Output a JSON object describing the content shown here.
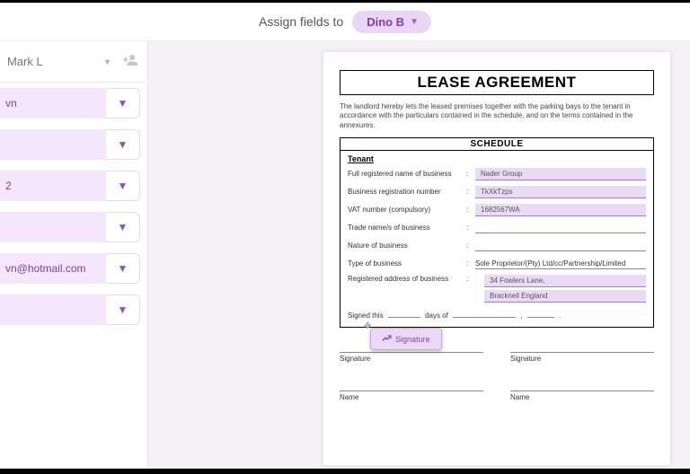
{
  "topbar": {
    "assign_label": "Assign fields to",
    "assignee": "Dino B"
  },
  "sidebar": {
    "current_user": "Mark L",
    "fields": [
      {
        "label": "vn"
      },
      {
        "label": ""
      },
      {
        "label": "2"
      },
      {
        "label": ""
      },
      {
        "label": "vn@hotmail.com"
      },
      {
        "label": ""
      }
    ]
  },
  "document": {
    "title": "LEASE AGREEMENT",
    "intro": "The landlord hereby lets the leased premises together with the parking bays to the tenant in accordance with the particulars contained in the schedule, and on the terms contained in the annexures.",
    "schedule_heading": "SCHEDULE",
    "tenant_heading": "Tenant",
    "rows": {
      "full_name_label": "Full registered name of business",
      "full_name_value": "Nader Group",
      "brn_label": "Business registration number",
      "brn_value": "TkXkTzps",
      "vat_label": "VAT number (compulsory)",
      "vat_value": "1682567WA",
      "trade_label": "Trade name/s of business",
      "nature_label": "Nature of business",
      "type_label": "Type of business",
      "type_value": "Sole Proprietor/(Pty) Ltd/cc/Partnership/Limited",
      "addr_label": "Registered address of business",
      "addr_line1": "34 Fowlers Lane,",
      "addr_line2": "Bracknell England"
    },
    "signed_prefix": "Signed this",
    "signed_days": "days of",
    "signature_caption": "Signature",
    "name_caption": "Name",
    "drag_field_label": "Signature"
  }
}
